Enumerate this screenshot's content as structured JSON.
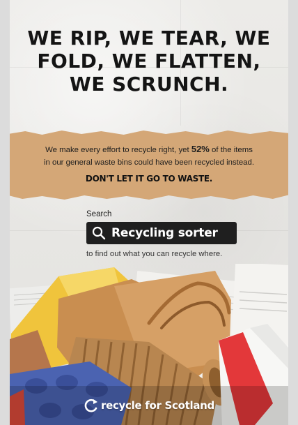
{
  "headline": {
    "line1": "WE RIP, WE TEAR, WE",
    "line2": "FOLD, WE FLATTEN,",
    "line3": "WE SCRUNCH."
  },
  "strip": {
    "line1_before": "We make every effort to recycle right, yet ",
    "stat": "52%",
    "line1_after": " of the items",
    "line2": "in our general waste bins could have been recycled instead.",
    "tagline": "DON'T LET IT GO TO WASTE."
  },
  "search": {
    "label": "Search",
    "button_text": "Recycling sorter",
    "caption": "to find out what you can recycle where."
  },
  "logo": {
    "text": "recycle for Scotland",
    "color": "#ffffff"
  },
  "colors": {
    "paper_strip": "#d4a777",
    "search_bg": "#1f1f1f",
    "text_dark": "#141414"
  },
  "icons": {
    "search": "magnifier-icon",
    "logo": "recycle-arrow-icon"
  }
}
